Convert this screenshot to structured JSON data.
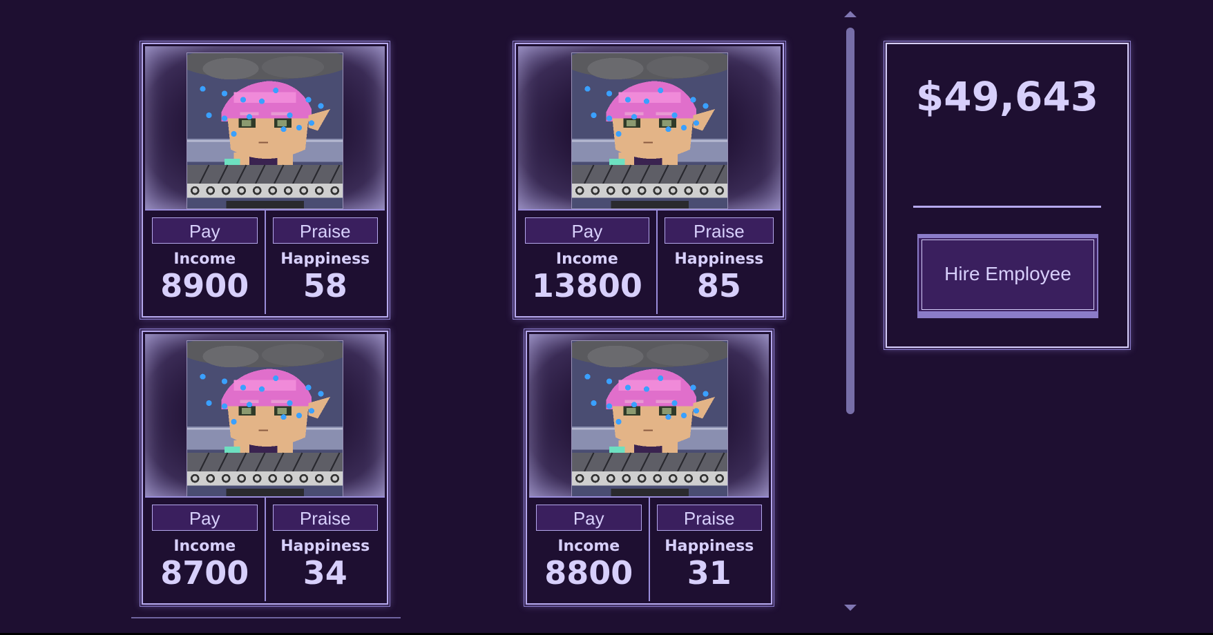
{
  "employees": [
    {
      "pay_label": "Pay",
      "praise_label": "Praise",
      "income_label": "Income",
      "income": "8900",
      "happiness_label": "Happiness",
      "happiness": "58"
    },
    {
      "pay_label": "Pay",
      "praise_label": "Praise",
      "income_label": "Income",
      "income": "13800",
      "happiness_label": "Happiness",
      "happiness": "85"
    },
    {
      "pay_label": "Pay",
      "praise_label": "Praise",
      "income_label": "Income",
      "income": "8700",
      "happiness_label": "Happiness",
      "happiness": "34"
    },
    {
      "pay_label": "Pay",
      "praise_label": "Praise",
      "income_label": "Income",
      "income": "8800",
      "happiness_label": "Happiness",
      "happiness": "31"
    }
  ],
  "panel": {
    "money": "$49,643",
    "hire_label": "Hire Employee"
  },
  "colors": {
    "background": "#1e0f31",
    "accent": "#b6a9ee",
    "text": "#d7cffb",
    "button": "#3a1f5e"
  },
  "icons": {
    "portrait": "stressed-pink-haired-employee-avatar",
    "scroll_up": "scroll-up-arrow-icon",
    "scroll_down": "scroll-down-arrow-icon"
  }
}
